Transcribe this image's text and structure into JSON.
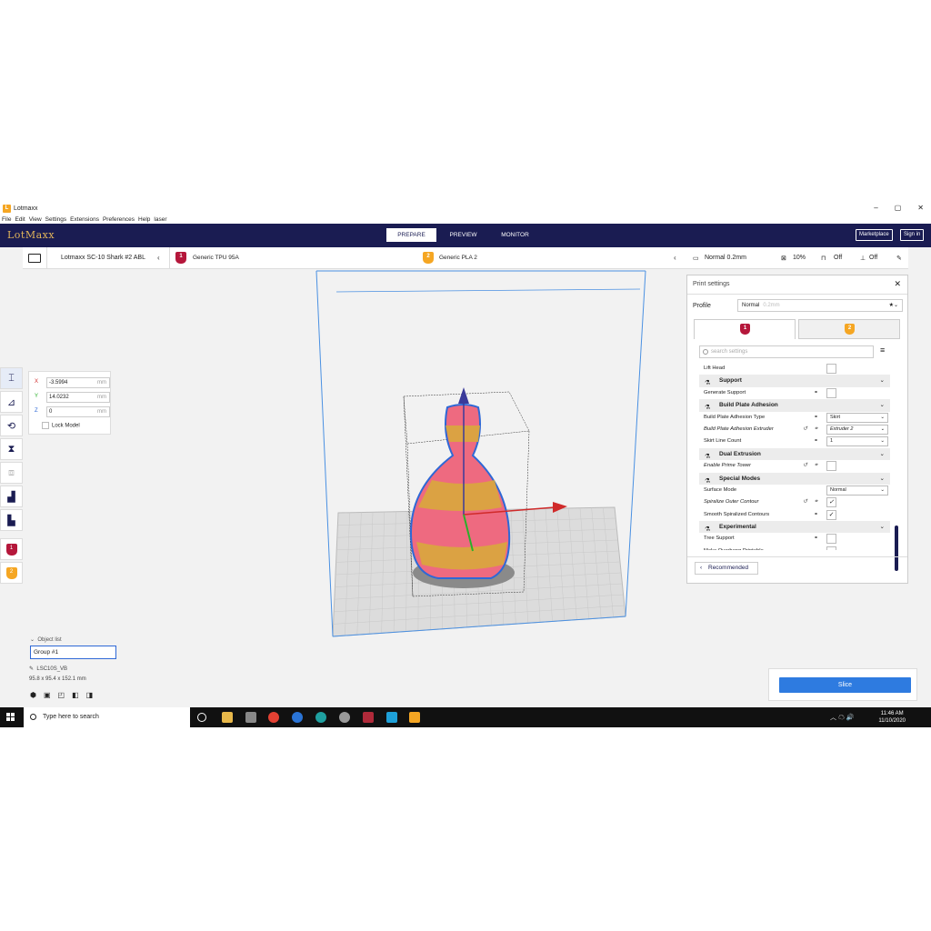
{
  "window": {
    "title": "Lotmaxx",
    "logo": "L",
    "controls": [
      "–",
      "▢",
      "✕"
    ]
  },
  "menu": [
    "File",
    "Edit",
    "View",
    "Settings",
    "Extensions",
    "Preferences",
    "Help",
    "laser"
  ],
  "header": {
    "brand": "LotMaxx",
    "stages": [
      "PREPARE",
      "PREVIEW",
      "MONITOR"
    ],
    "active_stage": "PREPARE",
    "marketplace": "Marketplace",
    "sign_in": "Sign in"
  },
  "toolbar": {
    "printer": "Lotmaxx SC-10 Shark #2 ABL",
    "extruders": [
      {
        "num": "1",
        "label": "Generic TPU 95A",
        "color": "#b5173b"
      },
      {
        "num": "2",
        "label": "Generic PLA 2",
        "color": "#f5a623"
      }
    ]
  },
  "settings_bar": {
    "profile": "Normal 0.2mm",
    "infill": "10%",
    "support": "Off",
    "adhesion": "Off"
  },
  "print_settings": {
    "title": "Print settings",
    "close": "✕",
    "profile_label": "Profile",
    "profile_value": "Normal",
    "profile_hint": "0.2mm",
    "tabs": [
      "1",
      "2"
    ],
    "search_placeholder": "search settings",
    "rows": [
      {
        "label": "Lift Head",
        "type": "check",
        "checked": false
      },
      {
        "label": "Support",
        "type": "category",
        "icon": "support-icon"
      },
      {
        "label": "Generate Support",
        "type": "check",
        "checked": false,
        "link": true
      },
      {
        "label": "Build Plate Adhesion",
        "type": "category",
        "icon": "adhesion-icon"
      },
      {
        "label": "Build Plate Adhesion Type",
        "type": "select",
        "value": "Skirt",
        "link": true
      },
      {
        "label": "Build Plate Adhesion Extruder",
        "type": "select",
        "value": "Extruder 2",
        "link": true,
        "reset": true,
        "italic": true
      },
      {
        "label": "Skirt Line Count",
        "type": "select",
        "value": "1",
        "link": true
      },
      {
        "label": "Dual Extrusion",
        "type": "category",
        "icon": "dual-extrusion-icon"
      },
      {
        "label": "Enable Prime Tower",
        "type": "check",
        "checked": false,
        "link": true,
        "reset": true,
        "italic": true
      },
      {
        "label": "Special Modes",
        "type": "category",
        "icon": "special-modes-icon"
      },
      {
        "label": "Surface Mode",
        "type": "select",
        "value": "Normal"
      },
      {
        "label": "Spiralize Outer Contour",
        "type": "check",
        "checked": true,
        "link": true,
        "reset": true,
        "italic": true
      },
      {
        "label": "Smooth Spiralized Contours",
        "type": "check",
        "checked": true,
        "link": true
      },
      {
        "label": "Experimental",
        "type": "category",
        "icon": "experimental-icon"
      },
      {
        "label": "Tree Support",
        "type": "check",
        "checked": false,
        "link": true
      },
      {
        "label": "Make Overhang Printable",
        "type": "check",
        "checked": false
      }
    ],
    "recommended": "Recommended"
  },
  "move_tool": {
    "x": "-3.5994",
    "y": "14.0232",
    "z": "0",
    "unit": "mm",
    "lock_model": "Lock Model"
  },
  "object_list": {
    "header": "Object list",
    "item": "Group #1",
    "name": "LSC10S_VB",
    "dims": "95.8 x 95.4 x 152.1 mm"
  },
  "slice": {
    "label": "Slice"
  },
  "taskbar": {
    "search": "Type here to search",
    "time": "11:46 AM",
    "date": "11/10/2020",
    "tray": "︿ ☁ 🔊"
  },
  "colors": {
    "navy": "#1a1c52",
    "accent": "#2e7be0",
    "ext1": "#b5173b",
    "ext2": "#f5a623",
    "brand": "#e2b55a"
  }
}
